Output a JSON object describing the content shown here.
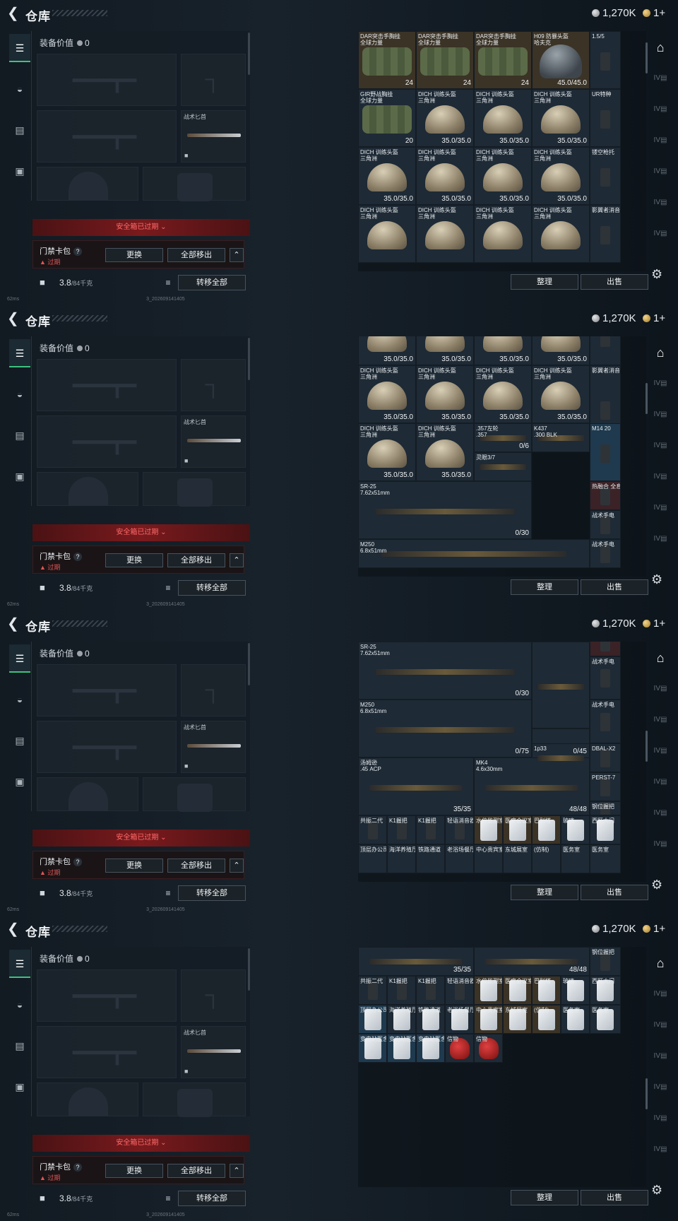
{
  "header": {
    "title": "仓库",
    "currency_silver": "1,270K",
    "currency_gold": "1+"
  },
  "left_nav": [
    "weapon-nav-icon",
    "helmet-nav-icon",
    "vest-nav-icon",
    "case-nav-icon"
  ],
  "equip": {
    "value_label": "装备价值",
    "value": "0",
    "knife_label": "战术匕首"
  },
  "safe_warning": "安全箱已过期",
  "card": {
    "label": "门禁卡包",
    "help": "?",
    "expired": "过期",
    "replace": "更换",
    "move_all": "全部移出"
  },
  "weight": {
    "value": "3.8",
    "cap": "/84千克"
  },
  "transfer_all": "转移全部",
  "status": {
    "ping": "62ms",
    "build": "3_202609141405"
  },
  "bottom": {
    "sort": "整理",
    "sell": "出售"
  },
  "frames": [
    {
      "items": [
        {
          "n": "DAR突击手胸挂\n全球力量",
          "v": "24",
          "a": "bag",
          "c": "tan"
        },
        {
          "n": "DAR突击手胸挂\n全球力量",
          "v": "24",
          "a": "bag",
          "c": "tan"
        },
        {
          "n": "DAR突击手胸挂\n全球力量",
          "v": "24",
          "a": "bag",
          "c": "tan"
        },
        {
          "n": "H09 防暴头盔\n哈夫克",
          "v": "45.0/45.0",
          "a": "helm2",
          "c": "tan"
        },
        {
          "n": "1.5/5",
          "v": "",
          "a": "sm",
          "c": ""
        },
        {
          "n": "GIR野战胸挂\n全球力量",
          "v": "20",
          "a": "bag",
          "c": ""
        },
        {
          "n": "DICH 训练头盔\n三角洲",
          "v": "35.0/35.0",
          "a": "helmet",
          "c": ""
        },
        {
          "n": "DICH 训练头盔\n三角洲",
          "v": "35.0/35.0",
          "a": "helmet",
          "c": ""
        },
        {
          "n": "DICH 训练头盔\n三角洲",
          "v": "35.0/35.0",
          "a": "helmet",
          "c": ""
        },
        {
          "n": "UR特种",
          "v": "",
          "a": "sm",
          "c": ""
        },
        {
          "n": "DICH 训练头盔\n三角洲",
          "v": "35.0/35.0",
          "a": "helmet",
          "c": ""
        },
        {
          "n": "DICH 训练头盔\n三角洲",
          "v": "35.0/35.0",
          "a": "helmet",
          "c": ""
        },
        {
          "n": "DICH 训练头盔\n三角洲",
          "v": "35.0/35.0",
          "a": "helmet",
          "c": ""
        },
        {
          "n": "DICH 训练头盔\n三角洲",
          "v": "35.0/35.0",
          "a": "helmet",
          "c": ""
        },
        {
          "n": "镂空枪托",
          "v": "",
          "a": "sm",
          "c": ""
        },
        {
          "n": "DICH 训练头盔\n三角洲",
          "v": "",
          "a": "helmet",
          "c": ""
        },
        {
          "n": "DICH 训练头盔\n三角洲",
          "v": "",
          "a": "helmet",
          "c": ""
        },
        {
          "n": "DICH 训练头盔\n三角洲",
          "v": "",
          "a": "helmet",
          "c": ""
        },
        {
          "n": "DICH 训练头盔\n三角洲",
          "v": "",
          "a": "helmet",
          "c": ""
        },
        {
          "n": "影翼者消音",
          "v": "",
          "a": "sm",
          "c": ""
        }
      ]
    },
    {
      "items": [
        {
          "n": "",
          "v": "35.0/35.0",
          "a": "helmet",
          "c": ""
        },
        {
          "n": "",
          "v": "35.0/35.0",
          "a": "helmet",
          "c": ""
        },
        {
          "n": "",
          "v": "35.0/35.0",
          "a": "helmet",
          "c": ""
        },
        {
          "n": "",
          "v": "35.0/35.0",
          "a": "helmet",
          "c": ""
        },
        {
          "n": "",
          "v": "",
          "a": "sm",
          "c": ""
        },
        {
          "n": "DICH 训练头盔\n三角洲",
          "v": "35.0/35.0",
          "a": "helmet",
          "c": ""
        },
        {
          "n": "DICH 训练头盔\n三角洲",
          "v": "35.0/35.0",
          "a": "helmet",
          "c": ""
        },
        {
          "n": "DICH 训练头盔\n三角洲",
          "v": "35.0/35.0",
          "a": "helmet",
          "c": ""
        },
        {
          "n": "DICH 训练头盔\n三角洲",
          "v": "35.0/35.0",
          "a": "helmet",
          "c": ""
        },
        {
          "n": "影翼者消音",
          "v": "",
          "a": "sm",
          "c": ""
        },
        {
          "n": "DICH 训练头盔\n三角洲",
          "v": "35.0/35.0",
          "a": "helmet",
          "c": ""
        },
        {
          "n": "DICH 训练头盔\n三角洲",
          "v": "35.0/35.0",
          "a": "helmet",
          "c": ""
        },
        {
          "n": ".357左轮\n.357",
          "v": "0/6",
          "a": "gun",
          "c": ""
        },
        {
          "n": "K437\n.300 BLK",
          "v": "",
          "a": "gun",
          "c": ""
        },
        {
          "n": "M14 20",
          "v": "",
          "a": "sm",
          "c": "blue"
        },
        {
          "n": "灵眼3/7",
          "v": "",
          "a": "gun",
          "c": ""
        },
        {
          "n": "热融合 全息",
          "v": "",
          "a": "sm",
          "c": "red"
        },
        {
          "n": "SR-25\n7.62x51mm",
          "v": "0/30",
          "a": "gun",
          "c": ""
        },
        {
          "n": "战术手电",
          "v": "",
          "a": "sm",
          "c": ""
        },
        {
          "n": "战术手电",
          "v": "",
          "a": "sm",
          "c": ""
        },
        {
          "n": "M250\n6.8x51mm",
          "v": "",
          "a": "gun",
          "c": ""
        }
      ]
    },
    {
      "items": [
        {
          "n": "35.0/35.0",
          "v": "",
          "a": "",
          "c": ""
        },
        {
          "n": "35.0/35.0",
          "v": "",
          "a": "",
          "c": ""
        },
        {
          "n": "热融合 全息",
          "v": "",
          "a": "sm",
          "c": "red"
        },
        {
          "n": "SR-25\n7.62x51mm",
          "v": "0/30",
          "a": "gun",
          "c": ""
        },
        {
          "n": "",
          "v": "",
          "a": "gun",
          "c": ""
        },
        {
          "n": "战术手电",
          "v": "",
          "a": "sm",
          "c": ""
        },
        {
          "n": "M250\n6.8x51mm",
          "v": "0/75",
          "a": "gun",
          "c": ""
        },
        {
          "n": "",
          "v": "0/45",
          "a": "",
          "c": ""
        },
        {
          "n": "战术手电",
          "v": "",
          "a": "sm",
          "c": ""
        },
        {
          "n": "1p33",
          "v": "",
          "a": "gun",
          "c": ""
        },
        {
          "n": "DBAL-X2",
          "v": "",
          "a": "sm",
          "c": ""
        },
        {
          "n": "汤姆逊\n.45 ACP",
          "v": "35/35",
          "a": "gun",
          "c": ""
        },
        {
          "n": "MK4\n4.6x30mm",
          "v": "48/48",
          "a": "gun",
          "c": ""
        },
        {
          "n": "PERST-7",
          "v": "",
          "a": "sm",
          "c": ""
        },
        {
          "n": "钢位握把",
          "v": "",
          "a": "sm",
          "c": ""
        },
        {
          "n": "共振二代",
          "v": "",
          "a": "sm",
          "c": ""
        },
        {
          "n": "K1握把",
          "v": "",
          "a": "sm",
          "c": ""
        },
        {
          "n": "K1握把",
          "v": "",
          "a": "sm",
          "c": ""
        },
        {
          "n": "轻语消音器",
          "v": "",
          "a": "sm",
          "c": ""
        },
        {
          "n": "水位监测室",
          "v": "",
          "a": "card",
          "c": "tan"
        },
        {
          "n": "医疗会议室",
          "v": "",
          "a": "card",
          "c": "tan"
        },
        {
          "n": "巴别塔",
          "v": "",
          "a": "card",
          "c": "tan"
        },
        {
          "n": "玻璃",
          "v": "",
          "a": "card",
          "c": ""
        },
        {
          "n": "西区大门",
          "v": "",
          "a": "card",
          "c": ""
        },
        {
          "n": "顶层办公司",
          "v": "",
          "a": "",
          "c": ""
        },
        {
          "n": "海洋养殖厅",
          "v": "",
          "a": "",
          "c": ""
        },
        {
          "n": "铁路通道",
          "v": "",
          "a": "",
          "c": ""
        },
        {
          "n": "老浴场餐厅",
          "v": "",
          "a": "",
          "c": ""
        },
        {
          "n": "中心贵宾室",
          "v": "",
          "a": "",
          "c": ""
        },
        {
          "n": "东城展室",
          "v": "",
          "a": "",
          "c": ""
        },
        {
          "n": "(仿制)",
          "v": "",
          "a": "",
          "c": ""
        },
        {
          "n": "医务室",
          "v": "",
          "a": "",
          "c": ""
        },
        {
          "n": "医务室",
          "v": "",
          "a": "",
          "c": ""
        }
      ]
    },
    {
      "items": [
        {
          "n": "",
          "v": "35/35",
          "a": "gun",
          "c": ""
        },
        {
          "n": "",
          "v": "48/48",
          "a": "gun",
          "c": ""
        },
        {
          "n": "钢位握把",
          "v": "",
          "a": "sm",
          "c": ""
        },
        {
          "n": "共振二代",
          "v": "",
          "a": "sm",
          "c": ""
        },
        {
          "n": "K1握把",
          "v": "",
          "a": "sm",
          "c": ""
        },
        {
          "n": "K1握把",
          "v": "",
          "a": "sm",
          "c": ""
        },
        {
          "n": "轻语消音器",
          "v": "",
          "a": "sm",
          "c": ""
        },
        {
          "n": "水位监测室",
          "v": "",
          "a": "card",
          "c": "tan"
        },
        {
          "n": "医疗会议室",
          "v": "",
          "a": "card",
          "c": "tan"
        },
        {
          "n": "巴别塔",
          "v": "",
          "a": "card",
          "c": "tan"
        },
        {
          "n": "玻璃",
          "v": "",
          "a": "card",
          "c": ""
        },
        {
          "n": "西区大门",
          "v": "",
          "a": "card",
          "c": ""
        },
        {
          "n": "顶层办公司",
          "v": "",
          "a": "card",
          "c": "blue"
        },
        {
          "n": "海洋养殖厅",
          "v": "",
          "a": "card",
          "c": ""
        },
        {
          "n": "铁路通道",
          "v": "",
          "a": "card",
          "c": ""
        },
        {
          "n": "老浴场餐厅",
          "v": "",
          "a": "card",
          "c": ""
        },
        {
          "n": "中心贵宾室",
          "v": "",
          "a": "card",
          "c": "tan"
        },
        {
          "n": "东城展室",
          "v": "",
          "a": "card",
          "c": "tan"
        },
        {
          "n": "(仿制)",
          "v": "",
          "a": "card",
          "c": "tan"
        },
        {
          "n": "医务室",
          "v": "",
          "a": "card",
          "c": ""
        },
        {
          "n": "医务室",
          "v": "",
          "a": "card",
          "c": ""
        },
        {
          "n": "变电站医舍",
          "v": "",
          "a": "card",
          "c": "blue"
        },
        {
          "n": "变电站医舍",
          "v": "",
          "a": "card",
          "c": "blue"
        },
        {
          "n": "变电站医舍",
          "v": "",
          "a": "card",
          "c": "blue"
        },
        {
          "n": "信物",
          "v": "",
          "a": "mask",
          "c": ""
        },
        {
          "n": "信物",
          "v": "",
          "a": "mask",
          "c": ""
        }
      ]
    }
  ]
}
